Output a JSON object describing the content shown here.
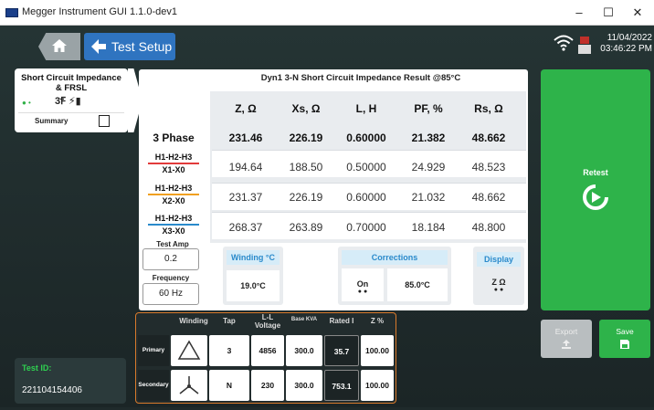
{
  "window": {
    "title": "Megger Instrument GUI 1.1.0-dev1",
    "min": "–",
    "max": "☐",
    "close": "✕"
  },
  "nav": {
    "back_label": "Test Setup"
  },
  "status": {
    "date": "11/04/2022",
    "time": "03:46:22 PM"
  },
  "test_card": {
    "title_line1": "Short Circuit Impedance",
    "title_line2": "& FRSL",
    "symbol": "3Ꞙ ⚡▮",
    "summary_label": "Summary"
  },
  "result": {
    "title": "Dyn1 3-N Short Circuit Impedance Result @85°C",
    "columns": [
      "Z, Ω",
      "Xs, Ω",
      "L, H",
      "PF, %",
      "Rs, Ω"
    ],
    "rows": [
      {
        "label1": "3 Phase",
        "label2": "",
        "color": "",
        "values": [
          "231.46",
          "226.19",
          "0.60000",
          "21.382",
          "48.662"
        ]
      },
      {
        "label1": "H1-H2-H3",
        "label2": "X1-X0",
        "color": "#e23b3b",
        "values": [
          "194.64",
          "188.50",
          "0.50000",
          "24.929",
          "48.523"
        ]
      },
      {
        "label1": "H1-H2-H3",
        "label2": "X2-X0",
        "color": "#f0a020",
        "values": [
          "231.37",
          "226.19",
          "0.60000",
          "21.032",
          "48.662"
        ]
      },
      {
        "label1": "H1-H2-H3",
        "label2": "X3-X0",
        "color": "#2a8acb",
        "values": [
          "268.37",
          "263.89",
          "0.70000",
          "18.184",
          "48.800"
        ]
      }
    ]
  },
  "inputs": {
    "test_amp_label": "Test Amp",
    "test_amp_value": "0.2",
    "frequency_label": "Frequency",
    "frequency_value": "60 Hz"
  },
  "winding_temp": {
    "label": "Winding °C",
    "value": "19.0°C"
  },
  "corrections": {
    "label": "Corrections",
    "state": "On",
    "value": "85.0°C"
  },
  "display": {
    "label": "Display",
    "value": "Z Ω"
  },
  "actions": {
    "retest": "Retest",
    "export": "Export",
    "save": "Save"
  },
  "winding_table": {
    "headers": [
      "Winding",
      "Tap",
      "L-L Voltage",
      "Base KVA",
      "Rated I",
      "Z %"
    ],
    "primary": {
      "label": "Primary",
      "tap": "3",
      "voltage": "4856",
      "kva": "300.0",
      "rated": "35.7",
      "z": "100.00"
    },
    "secondary": {
      "label": "Secondary",
      "tap": "N",
      "voltage": "230",
      "kva": "300.0",
      "rated": "753.1",
      "z": "100.00"
    }
  },
  "test_id": {
    "label": "Test ID:",
    "value": "221104154406"
  },
  "colors": {
    "accent_green": "#2eb34a",
    "accent_blue": "#2f74c0",
    "accent_orange": "#d97a2b"
  }
}
